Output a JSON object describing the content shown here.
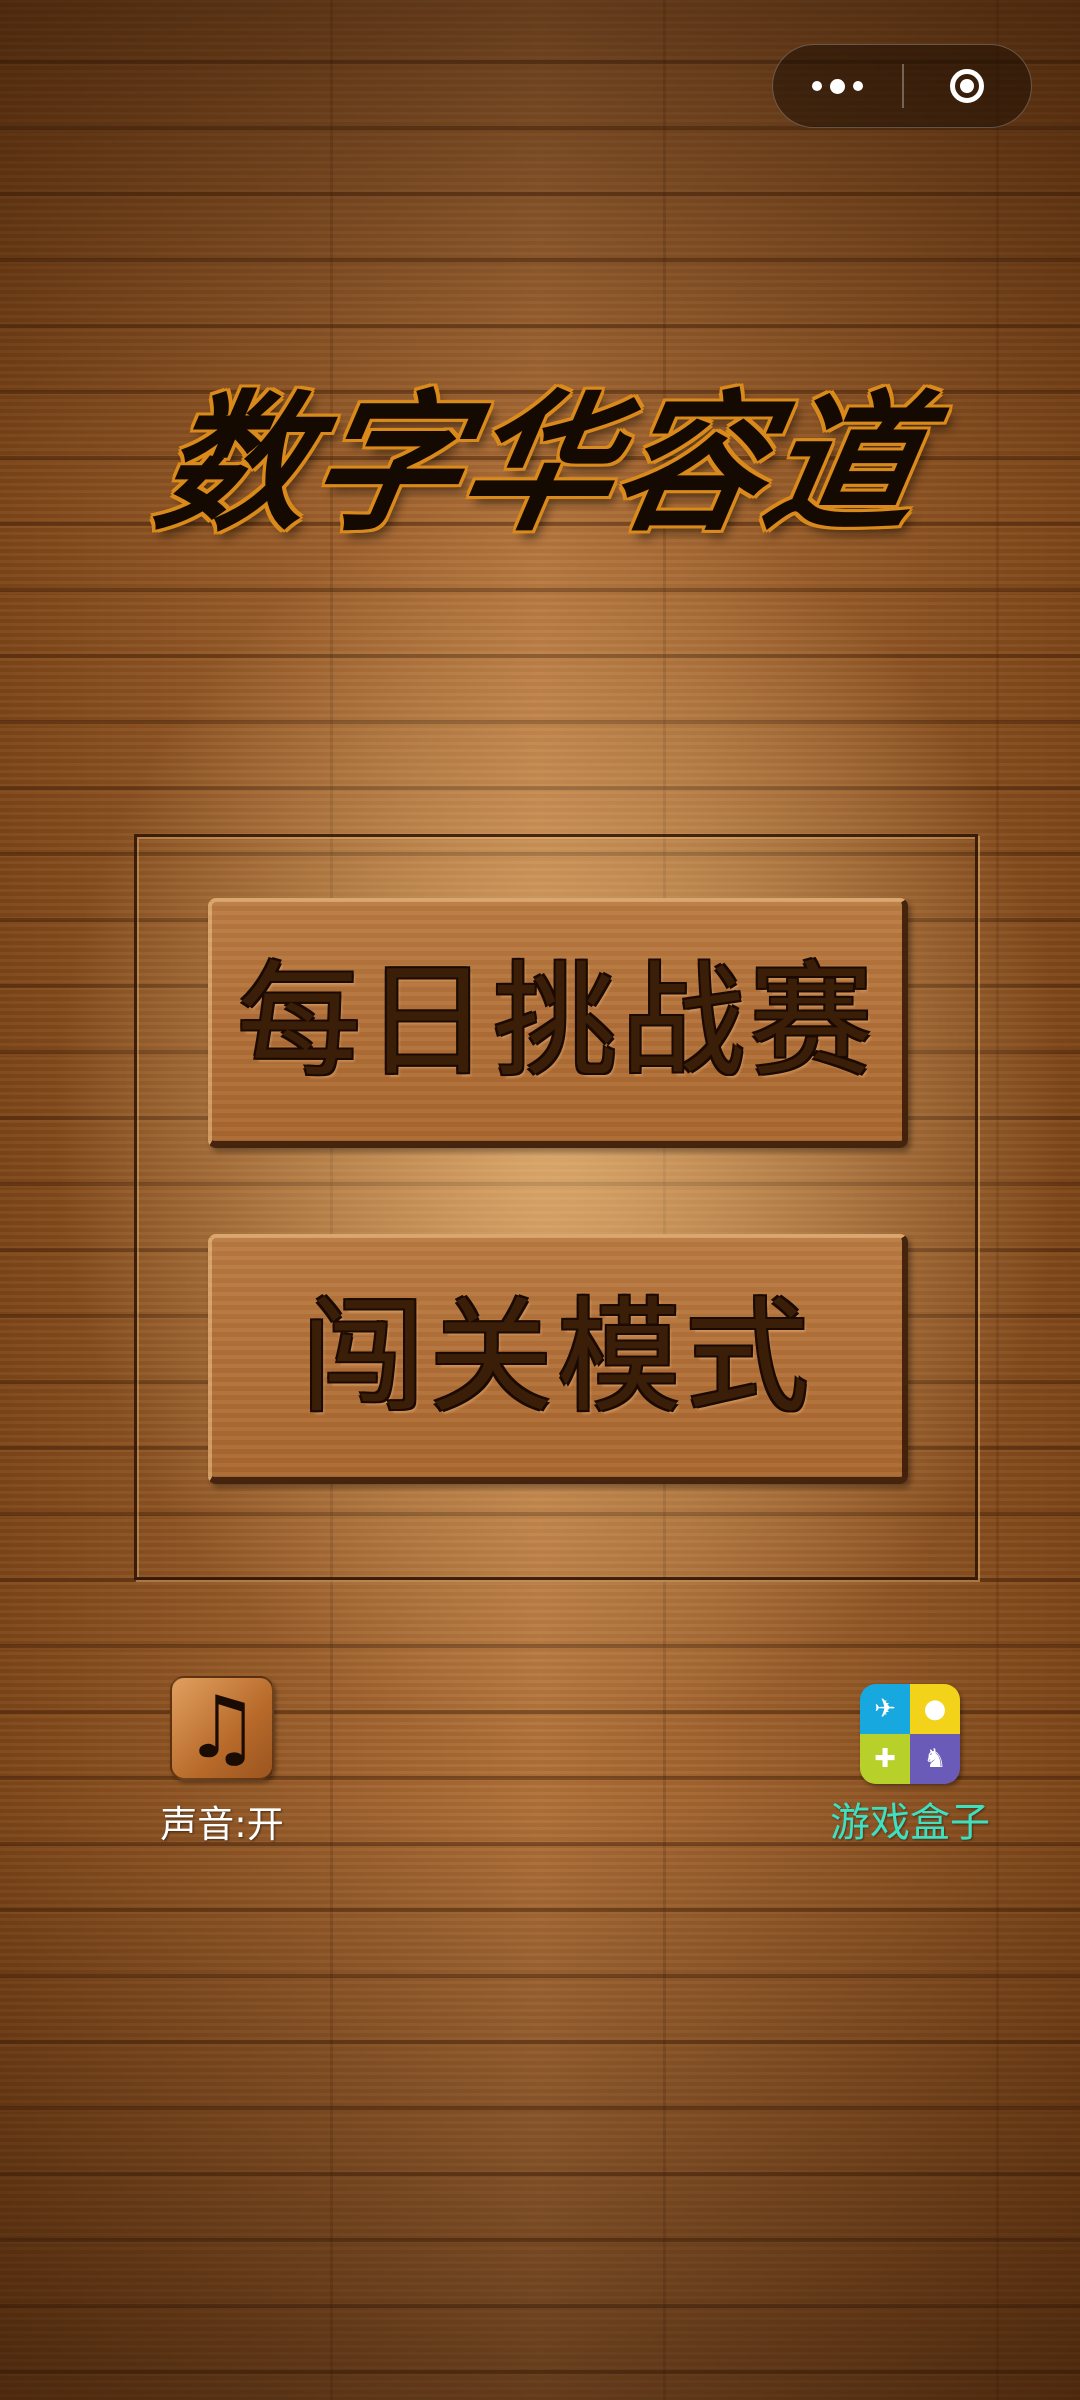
{
  "capsule": {
    "more_icon": "more-dots-icon",
    "close_icon": "close-circle-icon"
  },
  "title": "数字华容道",
  "menu": {
    "daily_label": "每日挑战赛",
    "levels_label": "闯关模式"
  },
  "sound": {
    "icon": "music-note-icon",
    "label": "声音:开"
  },
  "game_box": {
    "icon": "game-box-icon",
    "label": "游戏盒子"
  },
  "colors": {
    "wood": "#a8662f",
    "title_outline": "#d98a1a",
    "game_box_label": "#3ee0c0"
  }
}
